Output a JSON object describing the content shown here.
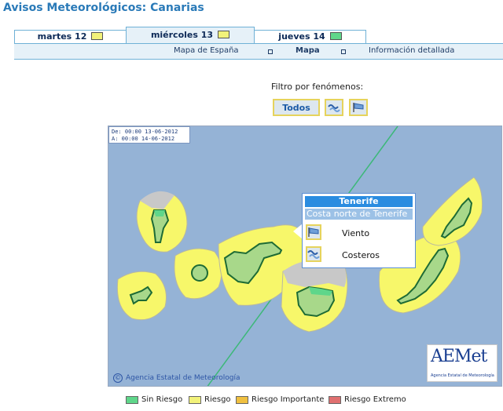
{
  "page": {
    "title": "Avisos Meteorológicos: Canarias"
  },
  "tabs": [
    {
      "label": "martes 12",
      "color": "#f2f27a"
    },
    {
      "label": "miércoles 13",
      "color": "#f2f27a",
      "active": true
    },
    {
      "label": "jueves 14",
      "color": "#5fd68a"
    }
  ],
  "subnav": {
    "items": [
      "Mapa de España",
      "Mapa",
      "Información detallada"
    ]
  },
  "filter": {
    "label": "Filtro por fenómenos:",
    "all_label": "Todos"
  },
  "map": {
    "date_from": "De: 00:00 13-06-2012",
    "date_to": "A:  00:00 14-06-2012",
    "credit": "Agencia Estatal de Meteorología",
    "credit_symbol": "©",
    "logo_text": "AEMet",
    "logo_sub": "Agencia Estatal de Meteorología"
  },
  "popup": {
    "island": "Tenerife",
    "zone": "Costa norte de Tenerife",
    "items": [
      {
        "label": "Viento",
        "icon": "wind-icon"
      },
      {
        "label": "Costeros",
        "icon": "waves-icon"
      }
    ]
  },
  "legend": [
    {
      "label": "Sin Riesgo",
      "color": "#5fd68a"
    },
    {
      "label": "Riesgo",
      "color": "#f2f27a"
    },
    {
      "label": "Riesgo Importante",
      "color": "#f0c040"
    },
    {
      "label": "Riesgo Extremo",
      "color": "#e07070"
    }
  ],
  "colors": {
    "accent": "#2a7ab8",
    "sea": "#95b3d6",
    "risk_zone": "#f7f76a",
    "no_risk_zone": "#c8c8c8",
    "island_outline": "#1e6b35",
    "island_fill": "#a8d88a"
  }
}
